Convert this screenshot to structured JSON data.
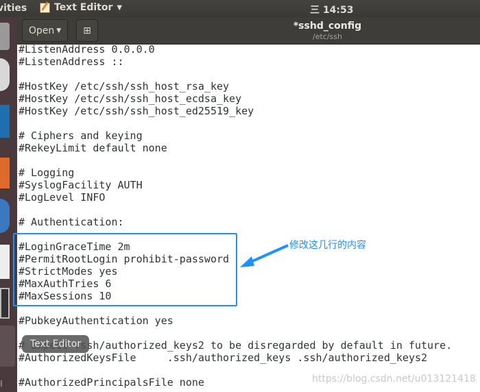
{
  "topbar": {
    "activities": "vities",
    "app_menu": "Text Editor",
    "clock": "三 14:53"
  },
  "header": {
    "open_label": "Open",
    "title": "*sshd_config",
    "subtitle": "/etc/ssh"
  },
  "editor": {
    "lines": [
      "#ListenAddress 0.0.0.0",
      "#ListenAddress ::",
      "",
      "#HostKey /etc/ssh/ssh_host_rsa_key",
      "#HostKey /etc/ssh/ssh_host_ecdsa_key",
      "#HostKey /etc/ssh/ssh_host_ed25519_key",
      "",
      "# Ciphers and keying",
      "#RekeyLimit default none",
      "",
      "# Logging",
      "#SyslogFacility AUTH",
      "#LogLevel INFO",
      "",
      "# Authentication:",
      "",
      "#LoginGraceTime 2m",
      "#PermitRootLogin prohibit-password",
      "#StrictModes yes",
      "#MaxAuthTries 6",
      "#MaxSessions 10",
      "",
      "#PubkeyAuthentication yes",
      "",
      "# Expect .ssh/authorized_keys2 to be disregarded by default in future.",
      "#AuthorizedKeysFile     .ssh/authorized_keys .ssh/authorized_keys2",
      "",
      "#AuthorizedPrincipalsFile none"
    ]
  },
  "annotation": {
    "text": "修改这几行的内容",
    "color": "#1e90ff"
  },
  "tooltip": "Text Editor",
  "watermark": "https://blog.csdn.net/u013121418"
}
